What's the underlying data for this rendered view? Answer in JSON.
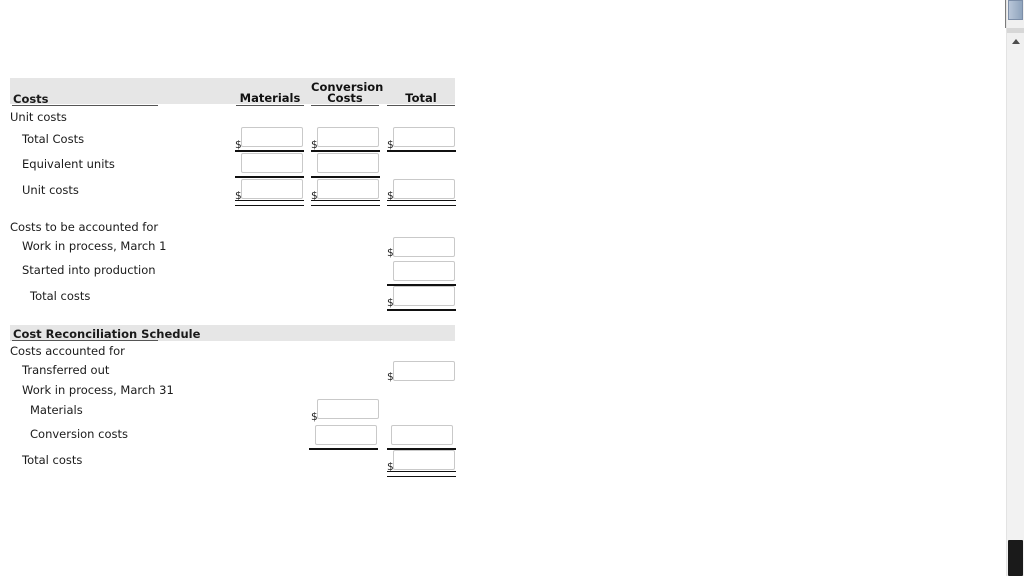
{
  "worksheet": {
    "header": {
      "costs_label": "Costs",
      "col_materials": "Materials",
      "col_conversion_line1": "Conversion",
      "col_conversion_line2": "Costs",
      "col_total": "Total"
    },
    "section_unit_costs": {
      "title": "Unit costs",
      "rows": [
        {
          "label": "Total Costs",
          "materials": "",
          "conversion": "",
          "total": ""
        },
        {
          "label": "Equivalent units",
          "materials": "",
          "conversion": "",
          "total": ""
        },
        {
          "label": "Unit costs",
          "materials": "",
          "conversion": "",
          "total": ""
        }
      ]
    },
    "section_costs_to_be_accounted": {
      "title": "Costs to be accounted for",
      "rows": [
        {
          "label": "Work in process, March 1",
          "total": ""
        },
        {
          "label": "Started into production",
          "total": ""
        },
        {
          "label": "Total costs",
          "total": ""
        }
      ]
    },
    "section_reconciliation": {
      "title": "Cost Reconciliation Schedule",
      "subtitle": "Costs accounted for",
      "rows": [
        {
          "label": "Transferred out",
          "value": ""
        },
        {
          "label": "Work in process, March 31"
        },
        {
          "label": "Materials",
          "value": ""
        },
        {
          "label": "Conversion costs",
          "value": "",
          "value2": ""
        },
        {
          "label": "Total costs",
          "value": ""
        }
      ]
    },
    "currency_symbol": "$"
  },
  "colors": {
    "header_band": "#e6e6e6",
    "rule": "#111111",
    "box_border": "#c9c9c9",
    "text": "#1a1a1a"
  }
}
